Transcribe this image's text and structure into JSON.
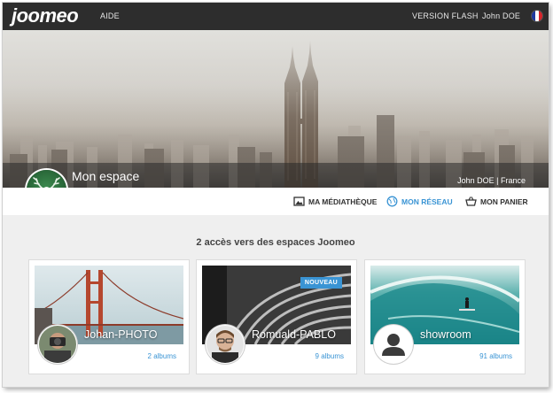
{
  "nav": {
    "logo": "joomeo",
    "help": "AIDE",
    "flash": "VERSION FLASH",
    "user": "John DOE",
    "language_flag_colors": [
      "#1f3aa0",
      "#ffffff",
      "#d9252b"
    ]
  },
  "hero": {
    "title": "Mon espace",
    "owner": "John DOE | France"
  },
  "toolbar": {
    "items": [
      {
        "label": "MA MÉDIATHÈQUE",
        "icon": "image-icon",
        "active": false
      },
      {
        "label": "MON RÉSEAU",
        "icon": "globe-network-icon",
        "active": true
      },
      {
        "label": "MON PANIER",
        "icon": "basket-icon",
        "active": false
      }
    ]
  },
  "content": {
    "heading": "2 accès vers des espaces Joomeo",
    "cards": [
      {
        "name": "Johan-PHOTO",
        "count": "2 albums",
        "badge": ""
      },
      {
        "name": "Romuald-PABLO",
        "count": "9 albums",
        "badge": "NOUVEAU"
      },
      {
        "name": "showroom",
        "count": "91 albums",
        "badge": ""
      }
    ]
  },
  "colors": {
    "accent": "#3a94d4",
    "topbar": "#2d2d2d",
    "content_bg": "#efefef"
  }
}
